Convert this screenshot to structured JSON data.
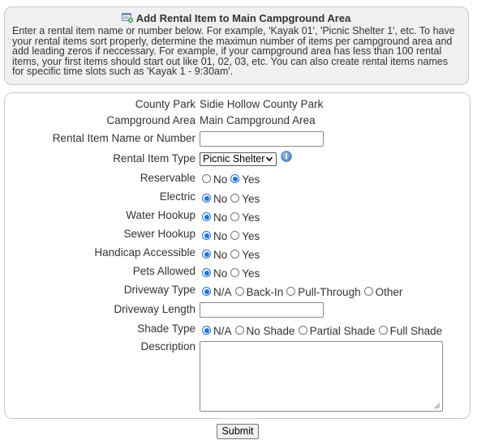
{
  "header": {
    "title": "Add Rental Item to Main Campground Area",
    "description": "Enter a rental item name or number below. For example, 'Kayak 01', 'Picnic Shelter 1', etc. To have your rental items sort properly, determine the maximun number of items per campground area and add leading zeros if neccessary. For example, if your campground area has less than 100 rental items, your first items should start out like 01, 02, 03, etc. You can also create rental items names for specific time slots such as 'Kayak 1 - 9:30am'."
  },
  "form": {
    "county_park_label": "County Park",
    "county_park_value": "Sidie Hollow County Park",
    "campground_area_label": "Campground Area",
    "campground_area_value": "Main Campground Area",
    "rental_item_label": "Rental Item Name or Number",
    "rental_item_value": "",
    "rental_type_label": "Rental Item Type",
    "rental_type_selected": "Picnic Shelter",
    "reservable": {
      "label": "Reservable",
      "options": [
        "No",
        "Yes"
      ],
      "selected": "Yes"
    },
    "electric": {
      "label": "Electric",
      "options": [
        "No",
        "Yes"
      ],
      "selected": "No"
    },
    "water_hookup": {
      "label": "Water Hookup",
      "options": [
        "No",
        "Yes"
      ],
      "selected": "No"
    },
    "sewer_hookup": {
      "label": "Sewer Hookup",
      "options": [
        "No",
        "Yes"
      ],
      "selected": "No"
    },
    "handicap": {
      "label": "Handicap Accessible",
      "options": [
        "No",
        "Yes"
      ],
      "selected": "No"
    },
    "pets": {
      "label": "Pets Allowed",
      "options": [
        "No",
        "Yes"
      ],
      "selected": "No"
    },
    "driveway_type": {
      "label": "Driveway Type",
      "options": [
        "N/A",
        "Back-In",
        "Pull-Through",
        "Other"
      ],
      "selected": "N/A"
    },
    "driveway_length_label": "Driveway Length",
    "driveway_length_value": "",
    "shade_type": {
      "label": "Shade Type",
      "options": [
        "N/A",
        "No Shade",
        "Partial Shade",
        "Full Shade"
      ],
      "selected": "N/A"
    },
    "description_label": "Description",
    "description_value": "",
    "submit_label": "Submit"
  },
  "icons": {
    "header_icon": "add-item-icon",
    "info_icon": "info-icon"
  },
  "colors": {
    "accent": "#1a73e8",
    "header_bg": "#f0f0f0",
    "border": "#c8c8c8"
  }
}
